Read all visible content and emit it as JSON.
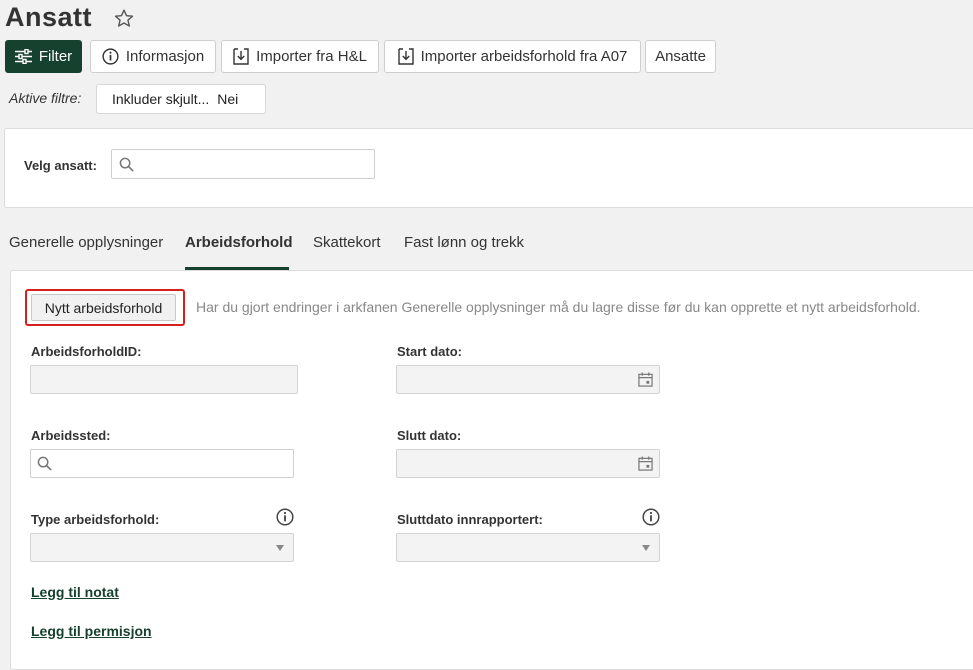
{
  "page": {
    "title": "Ansatt"
  },
  "toolbar": {
    "filter_label": "Filter",
    "info_label": "Informasjon",
    "import_hl_label": "Importer fra H&L",
    "import_a07_label": "Importer arbeidsforhold fra A07",
    "employees_label": "Ansatte"
  },
  "active_filters": {
    "label": "Aktive filtre:",
    "pill_name": "Inkluder skjult...",
    "pill_value": "Nei"
  },
  "employee_select": {
    "label": "Velg ansatt:",
    "value": ""
  },
  "tabs": [
    {
      "label": "Generelle opplysninger"
    },
    {
      "label": "Arbeidsforhold",
      "active": true
    },
    {
      "label": "Skattekort"
    },
    {
      "label": "Fast lønn og trekk"
    }
  ],
  "employment": {
    "new_button_label": "Nytt arbeidsforhold",
    "hint": "Har du gjort endringer i arkfanen Generelle opplysninger må du lagre disse før du kan opprette et nytt arbeidsforhold.",
    "fields": {
      "id_label": "ArbeidsforholdID:",
      "start_label": "Start dato:",
      "workplace_label": "Arbeidssted:",
      "end_label": "Slutt dato:",
      "type_label": "Type arbeidsforhold:",
      "end_reported_label": "Sluttdato innrapportert:"
    },
    "links": {
      "add_note": "Legg til notat",
      "add_leave": "Legg til permisjon"
    }
  },
  "colors": {
    "brand": "#17412f",
    "highlight": "#d62020"
  },
  "icons": [
    "star-icon",
    "filter-icon",
    "info-icon",
    "import-icon",
    "search-icon",
    "calendar-icon",
    "chevron-down-icon"
  ]
}
